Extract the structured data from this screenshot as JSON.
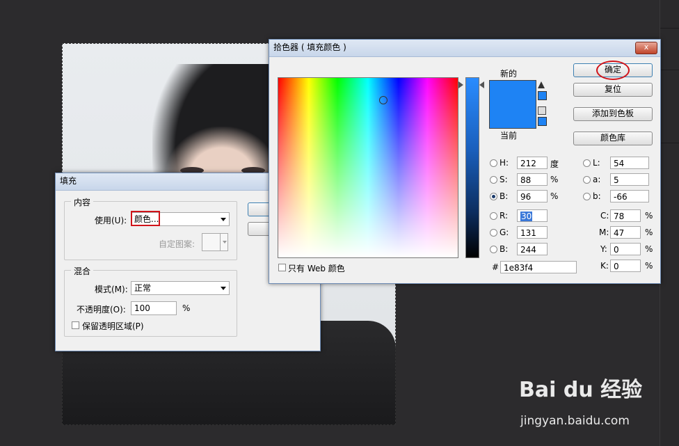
{
  "fill_dialog": {
    "title": "填充",
    "content_group": "内容",
    "use_label": "使用(U):",
    "use_value": "颜色...",
    "custom_pattern_label": "自定图案:",
    "blend_group": "混合",
    "mode_label": "模式(M):",
    "mode_value": "正常",
    "opacity_label": "不透明度(O):",
    "opacity_value": "100",
    "opacity_unit": "%",
    "preserve_label": "保留透明区域(P)"
  },
  "picker": {
    "title": "拾色器 ( 填充颜色 )",
    "close": "x",
    "new_label": "新的",
    "current_label": "当前",
    "new_color": "#1e83f4",
    "current_color": "#1e83f4",
    "ok": "确定",
    "reset": "复位",
    "add_swatch": "添加到色板",
    "libraries": "颜色库",
    "web_only_label": "只有 Web 颜色",
    "hex_prefix": "#",
    "hex_value": "1e83f4",
    "hsb": {
      "h_label": "H:",
      "h_value": "212",
      "h_unit": "度",
      "s_label": "S:",
      "s_value": "88",
      "s_unit": "%",
      "b_label": "B:",
      "b_value": "96",
      "b_unit": "%"
    },
    "rgb": {
      "r_label": "R:",
      "r_value": "30",
      "g_label": "G:",
      "g_value": "131",
      "b_label": "B:",
      "b_value": "244"
    },
    "lab": {
      "l_label": "L:",
      "l_value": "54",
      "a_label": "a:",
      "a_value": "5",
      "b_label": "b:",
      "b_value": "-66"
    },
    "cmyk": {
      "c_label": "C:",
      "c_value": "78",
      "c_unit": "%",
      "m_label": "M:",
      "m_value": "47",
      "m_unit": "%",
      "y_label": "Y:",
      "y_value": "0",
      "y_unit": "%",
      "k_label": "K:",
      "k_value": "0",
      "k_unit": "%"
    }
  },
  "watermark": {
    "brand": "Bai du 经验",
    "url": "jingyan.baidu.com"
  }
}
